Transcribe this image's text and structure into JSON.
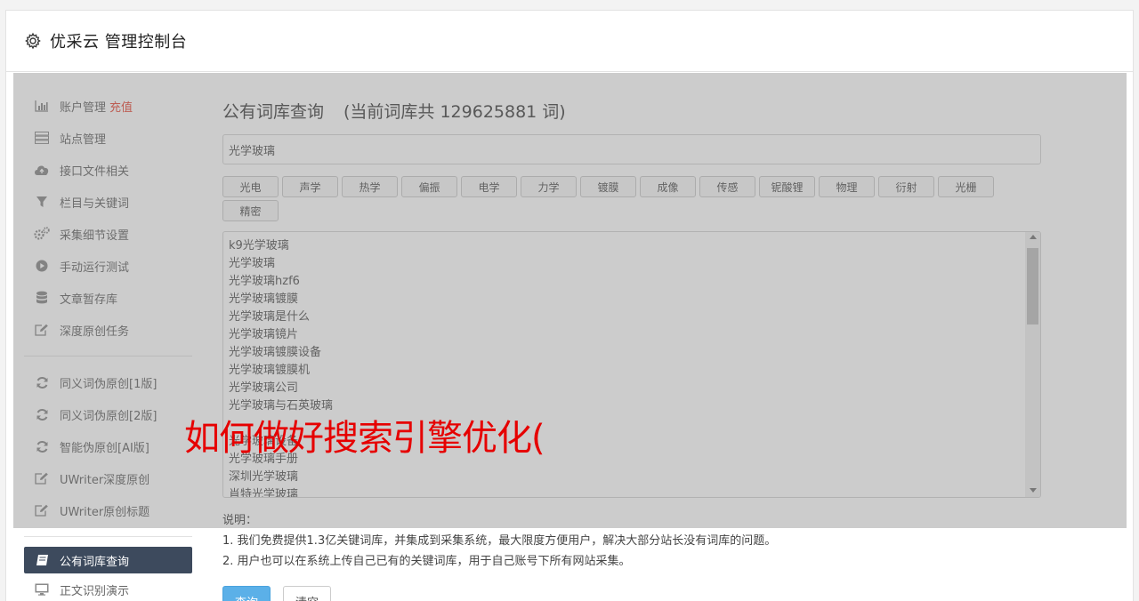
{
  "header": {
    "title": "优采云 管理控制台"
  },
  "sidebar": {
    "items": [
      {
        "label": "账户管理",
        "badge": "充值",
        "icon": "bar-chart-icon"
      },
      {
        "label": "站点管理",
        "icon": "server-icon"
      },
      {
        "label": "接口文件相关",
        "icon": "cloud-upload-icon"
      },
      {
        "label": "栏目与关键词",
        "icon": "filter-icon"
      },
      {
        "label": "采集细节设置",
        "icon": "gears-icon"
      },
      {
        "label": "手动运行测试",
        "icon": "play-icon"
      },
      {
        "label": "文章暂存库",
        "icon": "database-icon"
      },
      {
        "label": "深度原创任务",
        "icon": "edit-icon"
      }
    ],
    "items2": [
      {
        "label": "同义词伪原创[1版]",
        "icon": "refresh-icon"
      },
      {
        "label": "同义词伪原创[2版]",
        "icon": "refresh-icon"
      },
      {
        "label": "智能伪原创[AI版]",
        "icon": "refresh-icon"
      },
      {
        "label": "UWriter深度原创",
        "icon": "edit-icon"
      },
      {
        "label": "UWriter原创标题",
        "icon": "edit-icon"
      }
    ],
    "items3": [
      {
        "label": "公有词库查询",
        "icon": "book-icon"
      },
      {
        "label": "正文识别演示",
        "icon": "desktop-icon"
      }
    ]
  },
  "main": {
    "title": "公有词库查询",
    "count_text": "(当前词库共 129625881 词)",
    "search_value": "光学玻璃",
    "tags": [
      "光电",
      "声学",
      "热学",
      "偏振",
      "电学",
      "力学",
      "镀膜",
      "成像",
      "传感",
      "铌酸锂",
      "物理",
      "衍射",
      "光栅",
      "精密"
    ],
    "words": [
      "k9光学玻璃",
      "光学玻璃",
      "光学玻璃hzf6",
      "光学玻璃镀膜",
      "光学玻璃是什么",
      "光学玻璃镜片",
      "光学玻璃镀膜设备",
      "光学玻璃镀膜机",
      "光学玻璃公司",
      "光学玻璃与石英玻璃",
      "",
      "光学玻璃设备",
      "光学玻璃手册",
      "深圳光学玻璃",
      "肖特光学玻璃"
    ],
    "notes_title": "说明：",
    "note1": "1. 我们免费提供1.3亿关键词库，并集成到采集系统，最大限度方便用户，解决大部分站长没有词库的问题。",
    "note2": "2. 用户也可以在系统上传自己已有的关键词库，用于自己账号下所有网站采集。",
    "query_btn": "查询",
    "clear_btn": "清空"
  },
  "overlay_text": "如何做好搜索引擎优化(",
  "colors": {
    "active_nav": "#3d4a5d",
    "recharge": "#e74c3c",
    "primary_btn": "#5bb0e8",
    "overlay_text": "#e60000"
  }
}
